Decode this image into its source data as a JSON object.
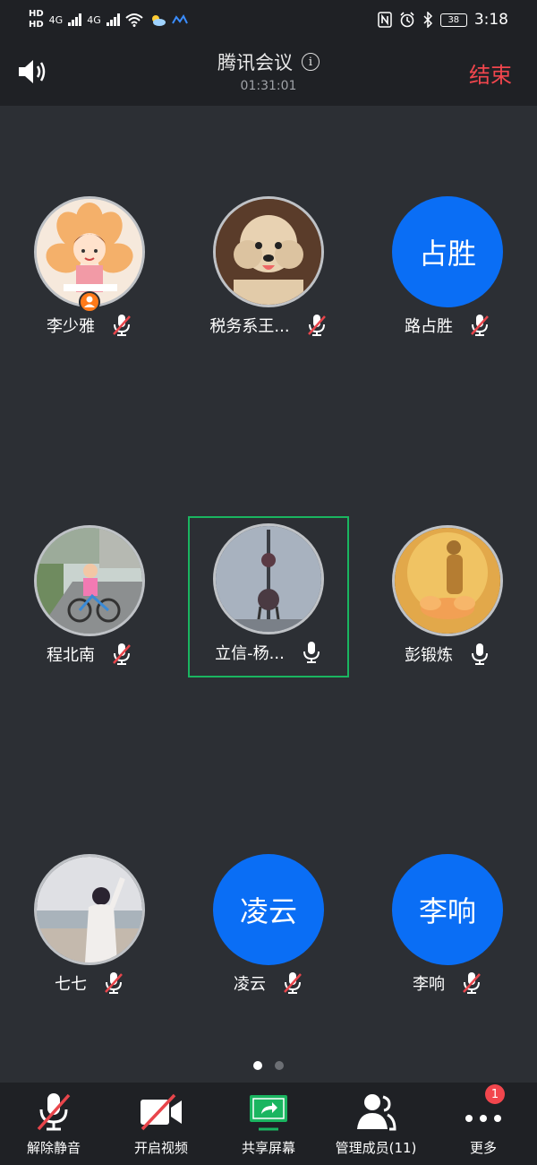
{
  "status_bar": {
    "hd_top": "HD",
    "hd_bottom": "HD",
    "net1": "4G",
    "net2": "4G",
    "battery": "38",
    "time": "3:18"
  },
  "header": {
    "title": "腾讯会议",
    "timer": "01:31:01",
    "end_label": "结束",
    "info_icon": "i"
  },
  "participants": [
    {
      "name": "李少雅",
      "avatar_type": "image",
      "mic": "muted",
      "host": true,
      "avatar_desc": "cartoon-girl-flower"
    },
    {
      "name": "税务系王...",
      "avatar_type": "image",
      "mic": "muted",
      "avatar_desc": "poodle-dog"
    },
    {
      "name": "路占胜",
      "avatar_type": "text",
      "avatar_text": "占胜",
      "mic": "muted"
    },
    {
      "name": "程北南",
      "avatar_type": "image",
      "mic": "muted",
      "avatar_desc": "child-on-bicycle"
    },
    {
      "name": "立信-杨...",
      "avatar_type": "image",
      "mic": "on",
      "active": true,
      "avatar_desc": "tv-tower"
    },
    {
      "name": "彭锻炼",
      "avatar_type": "image",
      "mic": "on",
      "avatar_desc": "golden-buddha"
    },
    {
      "name": "七七",
      "avatar_type": "image",
      "mic": "muted",
      "avatar_desc": "person-by-sea"
    },
    {
      "name": "凌云",
      "avatar_type": "text",
      "avatar_text": "凌云",
      "mic": "muted"
    },
    {
      "name": "李响",
      "avatar_type": "text",
      "avatar_text": "李响",
      "mic": "muted"
    }
  ],
  "toolbar": {
    "unmute": "解除静音",
    "video": "开启视频",
    "share": "共享屏幕",
    "members": "管理成员(11)",
    "more": "更多",
    "more_badge": "1"
  },
  "colors": {
    "background": "#2c2f34",
    "bar": "#1f2125",
    "accent_blue": "#0a6ef5",
    "end_red": "#f2464d",
    "active_green": "#1ab560",
    "mute_red": "#e8454b"
  }
}
